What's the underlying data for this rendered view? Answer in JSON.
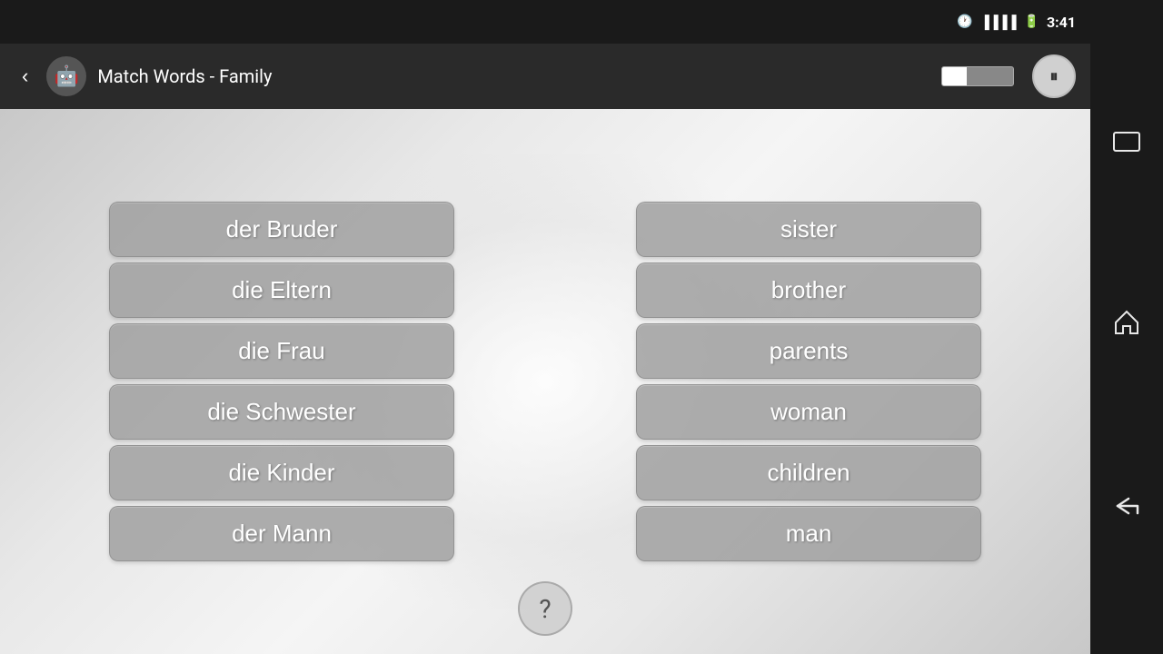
{
  "statusBar": {
    "time": "3:41",
    "icons": [
      "alarm",
      "signal",
      "battery"
    ]
  },
  "navBar": {
    "backLabel": "‹",
    "appIconLabel": "🤖",
    "title": "Match Words - Family",
    "progressPercent": 35,
    "pauseIcon": "⏸"
  },
  "leftColumn": {
    "words": [
      "der Bruder",
      "die Eltern",
      "die Frau",
      "die Schwester",
      "die Kinder",
      "der Mann"
    ]
  },
  "rightColumn": {
    "words": [
      "sister",
      "brother",
      "parents",
      "woman",
      "children",
      "man"
    ]
  },
  "helpButton": {
    "label": "?"
  },
  "rightPanel": {
    "squareIcon": "▭",
    "homeIcon": "⌂",
    "backIcon": "↩"
  }
}
